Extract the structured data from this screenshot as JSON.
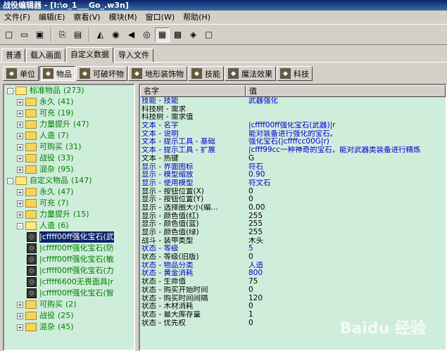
{
  "window": {
    "title": "战役编辑器 - [I:\\o_1___Go_.w3n]"
  },
  "menu": [
    "文件(F)",
    "编辑(E)",
    "察看(V)",
    "模块(M)",
    "窗口(W)",
    "帮助(H)"
  ],
  "toolbar_icons": [
    "new-icon",
    "open-icon",
    "save-icon",
    "copy-icon",
    "paste-icon",
    "terrain-icon",
    "trigger-icon",
    "sound-icon",
    "ai-icon",
    "object-icon",
    "campaign-icon",
    "import-icon",
    "test-icon"
  ],
  "tabs_top": [
    "普通",
    "载入画面",
    "自定义数据",
    "导入文件"
  ],
  "tabs_top_active": 2,
  "tabs_object": [
    {
      "label": "单位",
      "icon": "unit-icon"
    },
    {
      "label": "物品",
      "icon": "item-icon"
    },
    {
      "label": "可破坏物",
      "icon": "tree-icon"
    },
    {
      "label": "地形装饰物",
      "icon": "doodad-icon"
    },
    {
      "label": "技能",
      "icon": "ability-icon"
    },
    {
      "label": "魔法效果",
      "icon": "buff-icon"
    },
    {
      "label": "科技",
      "icon": "upgrade-icon"
    }
  ],
  "tabs_object_active": 1,
  "tree": [
    {
      "level": 0,
      "exp": "-",
      "label": "标准物品",
      "count": "(273)",
      "open": true
    },
    {
      "level": 1,
      "exp": "+",
      "label": "永久",
      "count": "(41)"
    },
    {
      "level": 1,
      "exp": "+",
      "label": "可充",
      "count": "(19)"
    },
    {
      "level": 1,
      "exp": "+",
      "label": "力量提升",
      "count": "(47)"
    },
    {
      "level": 1,
      "exp": "+",
      "label": "人造",
      "count": "(7)"
    },
    {
      "level": 1,
      "exp": "+",
      "label": "可购买",
      "count": "(31)"
    },
    {
      "level": 1,
      "exp": "+",
      "label": "战役",
      "count": "(33)"
    },
    {
      "level": 1,
      "exp": "+",
      "label": "混杂",
      "count": "(95)"
    },
    {
      "level": 0,
      "exp": "-",
      "label": "自定义物品",
      "count": "(147)",
      "open": true
    },
    {
      "level": 1,
      "exp": "+",
      "label": "永久",
      "count": "(47)"
    },
    {
      "level": 1,
      "exp": "+",
      "label": "可充",
      "count": "(7)"
    },
    {
      "level": 1,
      "exp": "+",
      "label": "力量提升",
      "count": "(15)"
    },
    {
      "level": 1,
      "exp": "-",
      "label": "人造",
      "count": "(6)",
      "open": true
    },
    {
      "level": 2,
      "item": true,
      "label": "|cffff00ff强化宝石(武",
      "sel": true
    },
    {
      "level": 2,
      "item": true,
      "label": "|cffff00ff强化宝石(防"
    },
    {
      "level": 2,
      "item": true,
      "label": "|cffff00ff强化宝石(敏"
    },
    {
      "level": 2,
      "item": true,
      "label": "|cffff00ff强化宝石(力"
    },
    {
      "level": 2,
      "item": true,
      "label": "|cffff6600无畏面具|r"
    },
    {
      "level": 2,
      "item": true,
      "label": "|cffff00ff强化宝石(智"
    },
    {
      "level": 1,
      "exp": "+",
      "label": "可购买",
      "count": "(2)"
    },
    {
      "level": 1,
      "exp": "+",
      "label": "战役",
      "count": "(25)"
    },
    {
      "level": 1,
      "exp": "+",
      "label": "混杂",
      "count": "(45)"
    }
  ],
  "grid": {
    "col_name": "名字",
    "col_value": "值",
    "rows": [
      {
        "k": "技能 - 技能",
        "v": "武器强化",
        "c": "blue"
      },
      {
        "k": "科技树 - 需求",
        "v": "",
        "c": "blk"
      },
      {
        "k": "科技树 - 需求值",
        "v": "",
        "c": "blk"
      },
      {
        "k": "文本 - 名字",
        "v": "|cffff00ff强化宝石(武器)|r",
        "c": "blue"
      },
      {
        "k": "文本 - 说明",
        "v": "能对装备进行强化的宝石。",
        "c": "blue"
      },
      {
        "k": "文本 - 提示工具 - 基础",
        "v": "强化宝石(|cffffcc00G|r)",
        "c": "blue"
      },
      {
        "k": "文本 - 提示工具 - 扩展",
        "v": "|cfff99cc一种神奇的宝石，能对武器类装备进行精炼",
        "c": "blue"
      },
      {
        "k": "文本 - 热键",
        "v": "G",
        "c": "blk"
      },
      {
        "k": "显示 - 界面图标",
        "v": "符石",
        "c": "blue"
      },
      {
        "k": "显示 - 模型缩放",
        "v": "0.90",
        "c": "blue"
      },
      {
        "k": "显示 - 使用模型",
        "v": "符文石",
        "c": "blue"
      },
      {
        "k": "显示 - 按钮位置(X)",
        "v": "0",
        "c": "blk"
      },
      {
        "k": "显示 - 按钮位置(Y)",
        "v": "0",
        "c": "blk"
      },
      {
        "k": "显示 - 选择圈大小(编...",
        "v": "0.00",
        "c": "blk"
      },
      {
        "k": "显示 - 颜色值(红)",
        "v": "255",
        "c": "blk"
      },
      {
        "k": "显示 - 颜色值(蓝)",
        "v": "255",
        "c": "blk"
      },
      {
        "k": "显示 - 颜色值(绿)",
        "v": "255",
        "c": "blk"
      },
      {
        "k": "战斗 - 装甲类型",
        "v": "木头",
        "c": "blk"
      },
      {
        "k": "状态 - 等级",
        "v": "5",
        "c": "blue"
      },
      {
        "k": "状态 - 等级(旧版)",
        "v": "0",
        "c": "blk"
      },
      {
        "k": "状态 - 物品分类",
        "v": "人造",
        "c": "blue"
      },
      {
        "k": "状态 - 黄金消耗",
        "v": "800",
        "c": "blue"
      },
      {
        "k": "状态 - 生命值",
        "v": "75",
        "c": "blk"
      },
      {
        "k": "状态 - 购买开始时间",
        "v": "0",
        "c": "blk"
      },
      {
        "k": "状态 - 购买时间间隔",
        "v": "120",
        "c": "blk"
      },
      {
        "k": "状态 - 木材消耗",
        "v": "0",
        "c": "blk"
      },
      {
        "k": "状态 - 最大库存量",
        "v": "1",
        "c": "blk"
      },
      {
        "k": "状态 - 优先权",
        "v": "0",
        "c": "blk"
      }
    ]
  },
  "watermark": "Baidu 经验"
}
